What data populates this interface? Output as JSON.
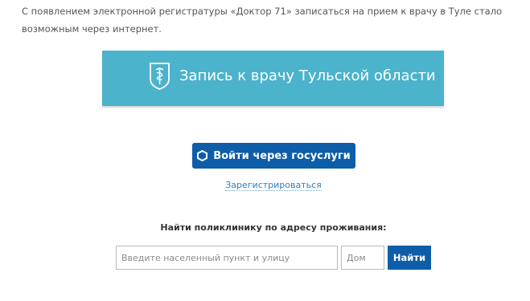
{
  "intro": {
    "text": "С появлением электронной регистратуры «Доктор 71» записаться на прием к врачу в Туле стало возможным через интернет."
  },
  "banner": {
    "title": "Запись к врачу Тульской области",
    "icon": "medical-shield-icon",
    "color": "#4bb3cc"
  },
  "gosuslugi": {
    "button_label": "Войти через госуслуги",
    "icon": "gosuslugi-hexagon-icon",
    "color": "#0d5da9"
  },
  "register": {
    "link_label": "Зарегистрироваться",
    "color": "#2f7fc1"
  },
  "search": {
    "label": "Найти поликлинику по адресу проживания:",
    "address_placeholder": "Введите населенный пункт и улицу",
    "address_value": "",
    "house_placeholder": "Дом",
    "house_value": "",
    "button_label": "Найти"
  }
}
